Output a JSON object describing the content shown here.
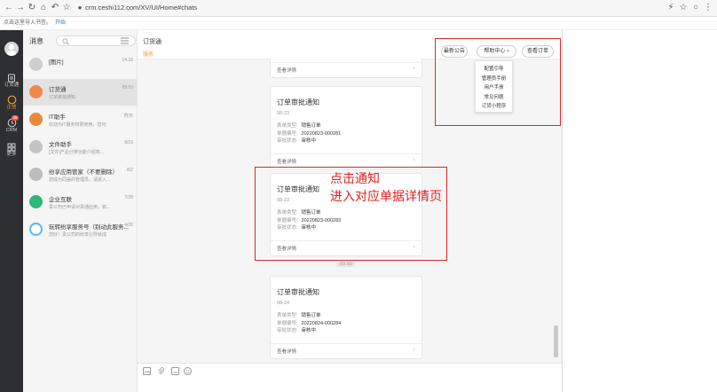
{
  "browser": {
    "url": "crm.ceshi112.com/XV/UI/Home#chats",
    "bookmark_text": "点击这里导入书签。",
    "bookmark_link": "开始"
  },
  "rail": {
    "items": [
      {
        "label": "订货通"
      },
      {
        "label": "企信"
      },
      {
        "label": "CRM",
        "badge": "28"
      },
      {
        "label": "更多"
      }
    ]
  },
  "conversations": {
    "title": "消息",
    "items": [
      {
        "name": "[图片]",
        "sub": "",
        "time": "14:16",
        "icon_color": "#cfcfcf"
      },
      {
        "name": "订货通",
        "sub": "订单审批通知",
        "time": "09:50",
        "icon_color": "#f0884a",
        "active": true
      },
      {
        "name": "IT助手",
        "sub": "欢迎为IT服务权限使用，您可",
        "time": "昨天",
        "icon_color": "#e98a3a"
      },
      {
        "name": "文件助手",
        "sub": "[文件]产品分类功能介绍简...",
        "time": "8/16",
        "icon_color": "#c4c4c4"
      },
      {
        "name": "纷享应用管家（不要删除）",
        "sub": "您成为同盖的管理员，请进入...",
        "time": "8/2",
        "icon_color": "#bdbdbd"
      },
      {
        "name": "企业互联",
        "sub": "贵公司已申请对贵通应用，如...",
        "time": "7/28",
        "icon_color": "#2fb67a"
      },
      {
        "name": "玩转纷享服务号（别动此服务...",
        "sub": "您好！贵公司的纷享引导就成",
        "time": "4/26",
        "icon_color": "#ffffff"
      }
    ]
  },
  "chat": {
    "title": "订货通",
    "subtitle": "服务",
    "header_buttons": {
      "announcement": "最新公告",
      "help": "帮助中心",
      "view_order": "查看订单"
    },
    "help_menu": [
      "配置引导",
      "管理员手册",
      "用户手册",
      "常见问题",
      "订货小程序"
    ],
    "top_card_footer": "查看详情",
    "time_divider": "09:50",
    "cards": [
      {
        "title": "订单审批通知",
        "date": "08-23",
        "rows": [
          {
            "k": "表单类型:",
            "v": "销售订单"
          },
          {
            "k": "单据编号:",
            "v": "20220823-000281"
          },
          {
            "k": "审批状态:",
            "v": "审核中"
          }
        ],
        "footer": "查看详情"
      },
      {
        "title": "订单审批通知",
        "date": "08-23",
        "rows": [
          {
            "k": "表单类型:",
            "v": "销售订单"
          },
          {
            "k": "单据编号:",
            "v": "20220823-000283"
          },
          {
            "k": "审批状态:",
            "v": "审核中"
          }
        ],
        "footer": "查看详情"
      },
      {
        "title": "订单审批通知",
        "date": "08-24",
        "rows": [
          {
            "k": "表单类型:",
            "v": "销售订单"
          },
          {
            "k": "单据编号:",
            "v": "20220824-000284"
          },
          {
            "k": "审批状态:",
            "v": "审核中"
          }
        ],
        "footer": "查看详情"
      }
    ]
  },
  "annotation": {
    "line1": "点击通知",
    "line2": "进入对应单据详情页",
    "color": "#e02020"
  },
  "icons": [
    "back-icon",
    "forward-icon",
    "reload-icon",
    "home-icon",
    "undo-icon",
    "star-icon",
    "lock-icon",
    "search-icon",
    "menu-icon",
    "image-icon",
    "attach-icon",
    "file-icon",
    "emoji-icon"
  ]
}
